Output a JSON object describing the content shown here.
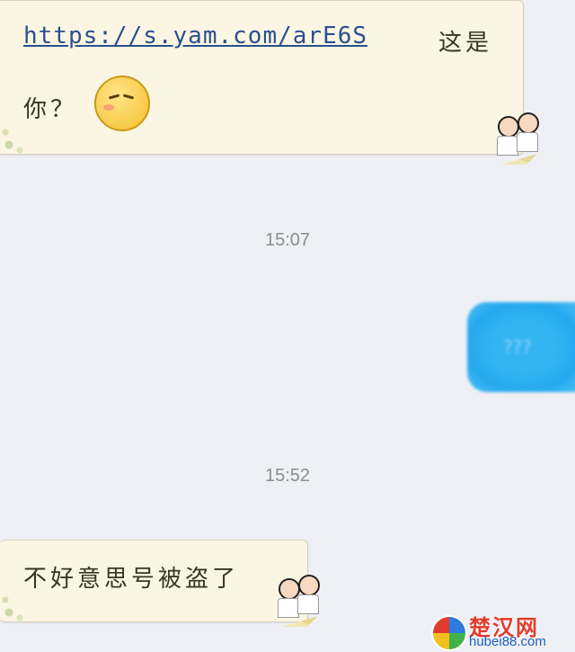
{
  "chat": {
    "messages": [
      {
        "link": "https://s.yam.com/arE6S",
        "text_after_link": "这是",
        "text_line2": "你？"
      },
      {
        "time": "15:07"
      },
      {
        "outgoing_text": "???"
      },
      {
        "time": "15:52"
      },
      {
        "text": "不好意思号被盗了"
      }
    ]
  },
  "watermark": {
    "title": "楚汉网",
    "url": "hubei88.com"
  },
  "colors": {
    "background": "#eef0f6",
    "incoming_bubble": "#fbf6e3",
    "outgoing_bubble": "#25a9ee",
    "link": "#2b4f8f"
  },
  "icons": [
    "emoji-face-icon",
    "avatar-couple-icon",
    "site-logo-icon"
  ]
}
